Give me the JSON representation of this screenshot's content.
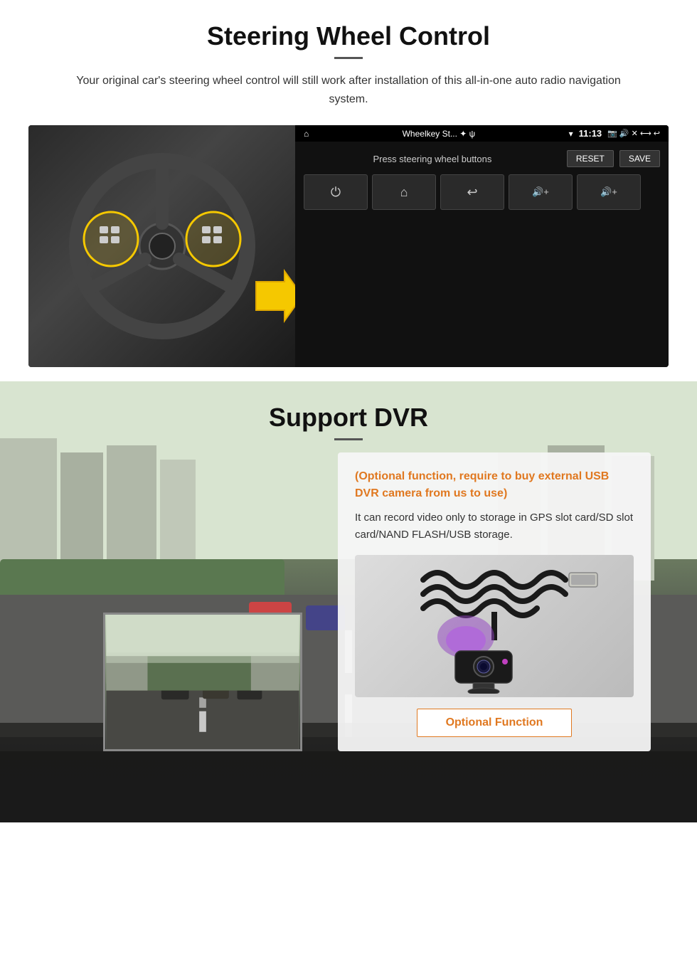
{
  "steering": {
    "title": "Steering Wheel Control",
    "description": "Your original car's steering wheel control will still work after installation of this all-in-one auto radio navigation system.",
    "statusbar": {
      "home_icon": "⌂",
      "app_name": "Wheelkey St... ✦ ψ",
      "wifi": "▾",
      "time": "11:13",
      "icons": "📷 🔊 ✕ ⟷ ↩"
    },
    "press_label": "Press steering wheel buttons",
    "reset_label": "RESET",
    "save_label": "SAVE",
    "buttons": [
      {
        "icon": "⏻",
        "label": "power"
      },
      {
        "icon": "⌂",
        "label": "home"
      },
      {
        "icon": "↩",
        "label": "back"
      },
      {
        "icon": "🔊+",
        "label": "vol-up"
      },
      {
        "icon": "🔊+",
        "label": "vol-up-2"
      }
    ]
  },
  "dvr": {
    "title": "Support DVR",
    "optional_text": "(Optional function, require to buy external USB DVR camera from us to use)",
    "description": "It can record video only to storage in GPS slot card/SD slot card/NAND FLASH/USB storage.",
    "optional_function_label": "Optional Function",
    "camera_alt": "USB DVR Camera"
  }
}
